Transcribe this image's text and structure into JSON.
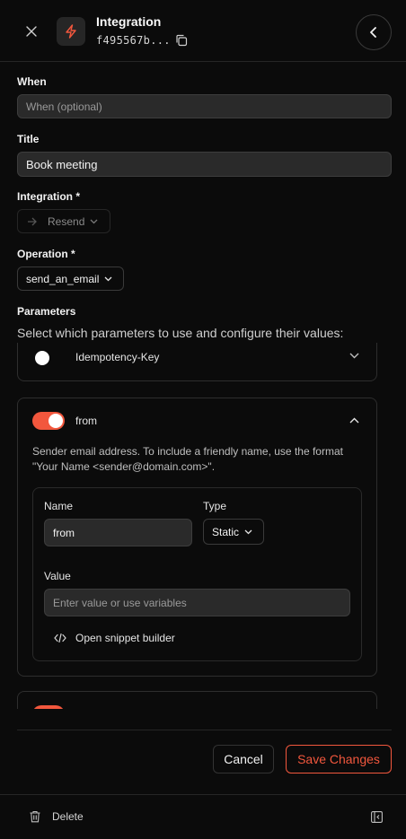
{
  "header": {
    "title": "Integration",
    "id": "f495567b...",
    "accent": "#f2573d"
  },
  "form": {
    "when": {
      "label": "When",
      "placeholder": "When (optional)"
    },
    "title": {
      "label": "Title",
      "value": "Book meeting"
    },
    "integration": {
      "label": "Integration *",
      "value": "Resend"
    },
    "operation": {
      "label": "Operation *",
      "value": "send_an_email"
    },
    "parameters": {
      "label": "Parameters",
      "description": "Select which parameters to use and configure their values:"
    }
  },
  "params": {
    "idempotency": {
      "name": "Idempotency-Key",
      "enabled": false
    },
    "from": {
      "name": "from",
      "enabled": true,
      "description_line1": "Sender email address. To include a friendly name, use the format",
      "description_line2": "\"Your Name <sender@domain.com>\".",
      "name_label": "Name",
      "name_value": "from",
      "type_label": "Type",
      "type_value": "Static",
      "value_label": "Value",
      "value_placeholder": "Enter value or use variables",
      "snippet_label": "Open snippet builder"
    }
  },
  "actions": {
    "cancel": "Cancel",
    "save": "Save Changes"
  },
  "footer": {
    "delete": "Delete"
  }
}
